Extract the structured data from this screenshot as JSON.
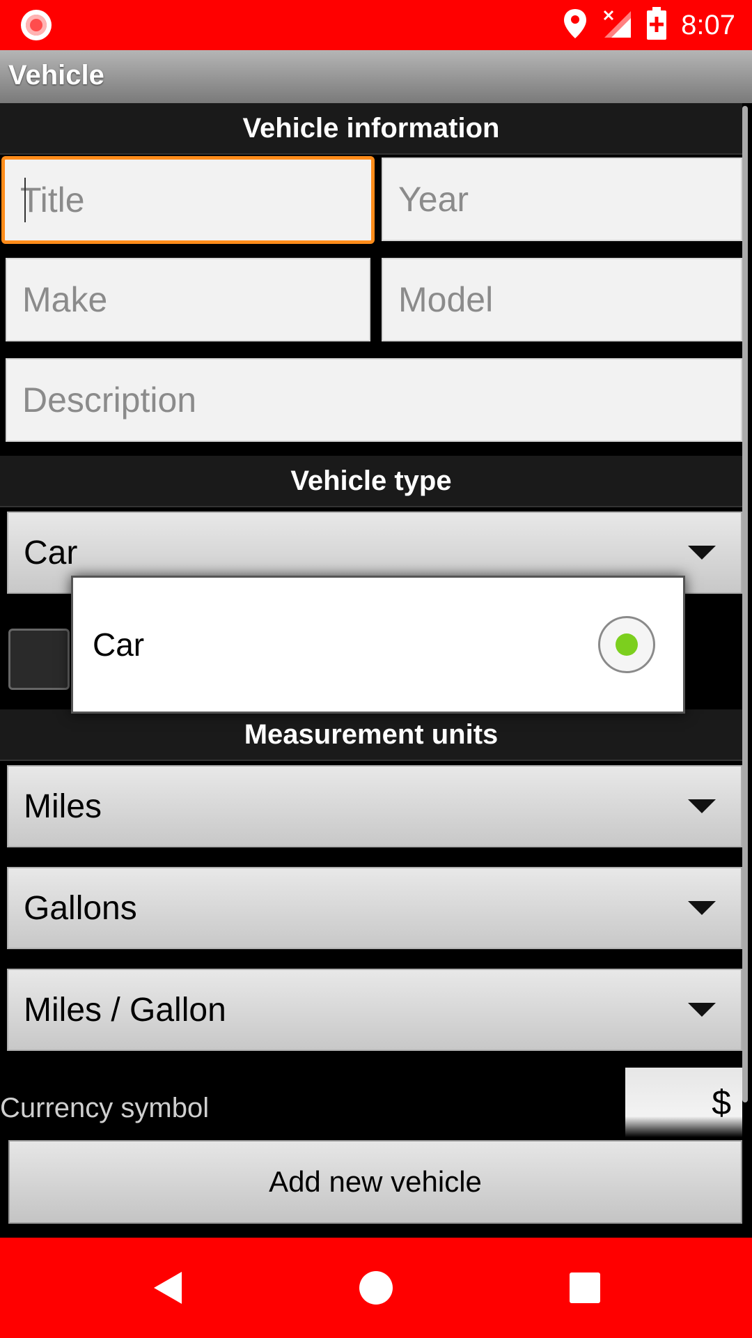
{
  "status_bar": {
    "time": "8:07",
    "icons": [
      "screen-record-icon",
      "location-icon",
      "signal-icon",
      "battery-icon"
    ],
    "color": "#ff0000"
  },
  "app_bar": {
    "title": "Vehicle"
  },
  "sections": {
    "info": "Vehicle information",
    "type": "Vehicle type",
    "units": "Measurement units"
  },
  "fields": {
    "title_placeholder": "Title",
    "year_placeholder": "Year",
    "make_placeholder": "Make",
    "model_placeholder": "Model",
    "description_placeholder": "Description"
  },
  "vehicle_type": {
    "selected": "Car"
  },
  "dropdown": {
    "options": [
      {
        "label": "Car",
        "selected": true
      }
    ]
  },
  "units": {
    "distance": "Miles",
    "volume": "Gallons",
    "economy": "Miles / Gallon"
  },
  "currency": {
    "label": "Currency symbol",
    "value": "$"
  },
  "actions": {
    "add_vehicle": "Add new vehicle"
  },
  "nav": {
    "icons": [
      "back-icon",
      "home-icon",
      "recents-icon"
    ]
  },
  "colors": {
    "accent_focus": "#ff8c1a",
    "radio_selected": "#7ccf1e",
    "system_bars": "#ff0000"
  }
}
